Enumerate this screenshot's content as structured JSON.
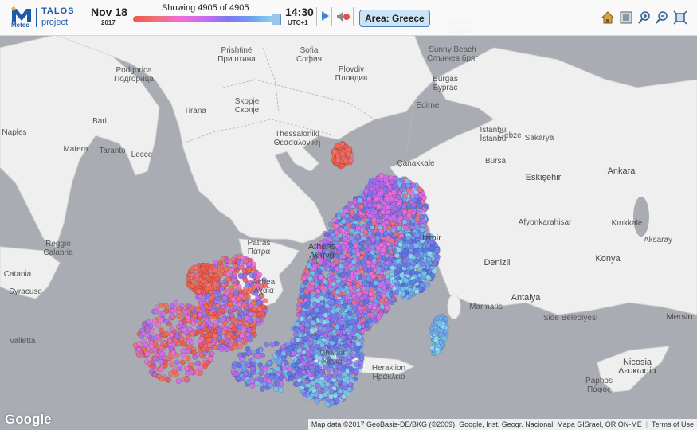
{
  "app": {
    "logo_top": "TALOS",
    "logo_bottom": "project",
    "logo_brand": "Meteo"
  },
  "toolbar": {
    "date": "Nov 18",
    "year": "2017",
    "showing": "Showing 4905 of 4905",
    "time": "14:30",
    "timezone": "UTC+1",
    "area_button": "Area: Greece",
    "timeline_progress": 1.0,
    "icons": [
      "home-icon",
      "layer-icon",
      "zoom-in-icon",
      "zoom-out-icon",
      "fullscreen-icon"
    ]
  },
  "map_labels": [
    {
      "t": "Podgorica\nПодгорица"
    },
    {
      "t": "Prishtinë\nПриштина"
    },
    {
      "t": "Sofia\nСофия"
    },
    {
      "t": "Plovdiv\nПловдив"
    },
    {
      "t": "Burgas\nБургас"
    },
    {
      "t": "Varna\nВарна"
    },
    {
      "t": "Sunny Beach\nСлънчев бряг"
    },
    {
      "t": "Edirne"
    },
    {
      "t": "Tirana"
    },
    {
      "t": "Skopje\nСкопје"
    },
    {
      "t": "Bari"
    },
    {
      "t": "Naples"
    },
    {
      "t": "Matera"
    },
    {
      "t": "Taranto"
    },
    {
      "t": "Lecce"
    },
    {
      "t": "Thessaloniki\nΘεσσαλονίκη"
    },
    {
      "t": "Istanbul\nİstanbul"
    },
    {
      "t": "Gebze"
    },
    {
      "t": "Sakarya"
    },
    {
      "t": "Bursa"
    },
    {
      "t": "Çanakkale"
    },
    {
      "t": "Eskişehir"
    },
    {
      "t": "Ankara"
    },
    {
      "t": "Afyonkarahisar"
    },
    {
      "t": "Kırıkkale"
    },
    {
      "t": "Aksaray"
    },
    {
      "t": "Konya"
    },
    {
      "t": "Patras\nΠάτρα"
    },
    {
      "t": "Athens\nΑθήνα"
    },
    {
      "t": "İzmir"
    },
    {
      "t": "Denizli"
    },
    {
      "t": "Antalya"
    },
    {
      "t": "Marmaris"
    },
    {
      "t": "Reggio\nCalabria"
    },
    {
      "t": "Catania"
    },
    {
      "t": "Syracuse"
    },
    {
      "t": "Valletta"
    },
    {
      "t": "Achea\nΑχαΐα"
    },
    {
      "t": "Chania\nΧανιά"
    },
    {
      "t": "Heraklion\nΗράκλειο"
    },
    {
      "t": "Nicosia\nΛευκωσία"
    },
    {
      "t": "Paphos\nΠάφος"
    },
    {
      "t": "Side Belediyesi"
    },
    {
      "t": "Mersin"
    }
  ],
  "footer": {
    "google": "Google",
    "attribution": "Map data ©2017 GeoBasis-DE/BKG (©2009), Google, Inst. Geogr. Nacional, Mapa GISrael, ORION-ME",
    "terms": "Terms of Use"
  },
  "colors": {
    "sea": "#a9adb3",
    "land": "#eeeeee",
    "accent": "#1f5aa6"
  }
}
